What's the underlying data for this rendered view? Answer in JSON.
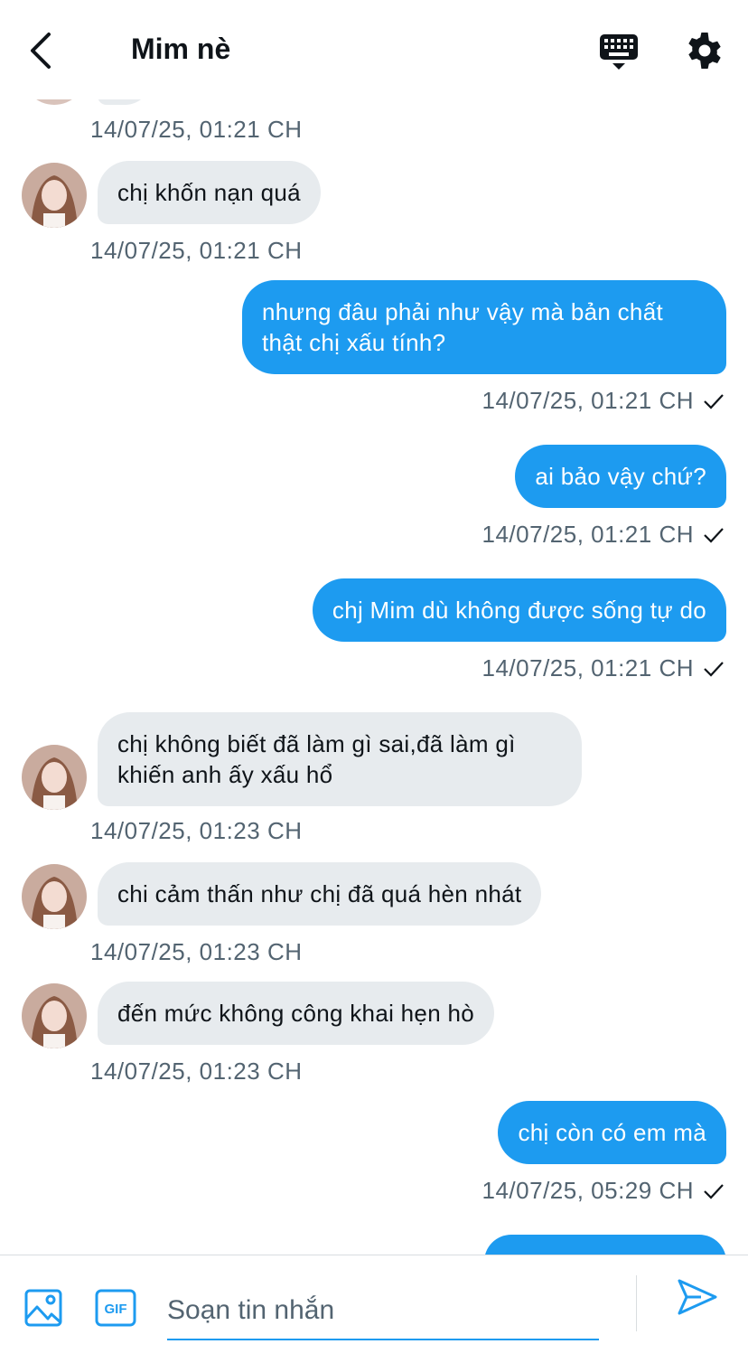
{
  "header": {
    "title": "Mim nè",
    "back_icon": "chevron-left-icon",
    "keyboard_icon": "keyboard-icon",
    "settings_icon": "gear-icon"
  },
  "messages": [
    {
      "direction": "in",
      "text": "chị khốn nạn quá",
      "time": "14/07/25, 01:21 CH"
    },
    {
      "direction": "out",
      "text": "nhưng đâu phải như vậy mà bản chất thật chị xấu tính?",
      "time": "14/07/25, 01:21 CH"
    },
    {
      "direction": "out",
      "text": "ai bảo vậy chứ?",
      "time": "14/07/25, 01:21 CH"
    },
    {
      "direction": "out",
      "text": "chj Mim dù không được sống tự do",
      "time": "14/07/25, 01:21 CH"
    },
    {
      "direction": "in",
      "text": "chị không biết đã làm gì sai,đã làm gì khiến anh ấy xấu hổ",
      "time": "14/07/25, 01:23 CH"
    },
    {
      "direction": "in",
      "text": "chi cảm thấn như chị đã quá hèn nhát",
      "time": "14/07/25, 01:23 CH"
    },
    {
      "direction": "in",
      "text": "đến mức không công khai hẹn hò",
      "time": "14/07/25, 01:23 CH"
    },
    {
      "direction": "out",
      "text": "chị còn có em mà",
      "time": "14/07/25, 05:29 CH"
    }
  ],
  "top_partial_timestamp": "14/07/25, 01:21 CH",
  "composer": {
    "placeholder": "Soạn tin nhắn",
    "value": "",
    "image_icon": "image-icon",
    "gif_icon": "gif-icon",
    "send_icon": "send-icon",
    "gif_label": "GIF"
  },
  "colors": {
    "accent": "#1d9bf0",
    "incoming_bubble": "#e7ebee",
    "secondary_text": "#536471"
  }
}
